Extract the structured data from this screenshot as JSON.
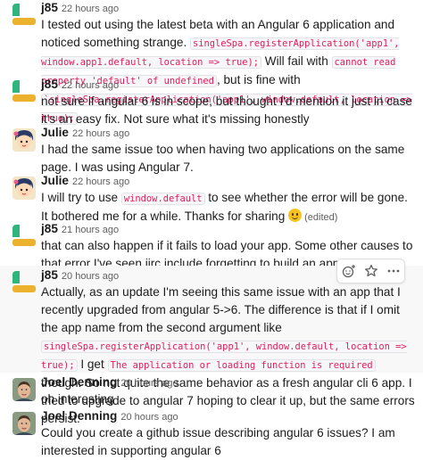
{
  "messages": [
    {
      "author": "j85",
      "time": "22 hours ago",
      "avatar": "slack-green-yellow",
      "parts": [
        {
          "t": "text",
          "v": "I tested out using the latest beta with an Angular 6 application and noticed something strange. "
        },
        {
          "t": "code",
          "v": "singleSpa.registerApplication('app1', window.app1.default, location => true);"
        },
        {
          "t": "text",
          "v": " Will fail with "
        },
        {
          "t": "code",
          "v": "cannot read property 'default' of undefined"
        },
        {
          "t": "text",
          "v": ", but is fine with "
        },
        {
          "t": "code",
          "v": "`singleSpa.registerApplication('app1', window.default, location => true);"
        }
      ]
    },
    {
      "author": "j85",
      "time": "22 hours ago",
      "avatar": "slack-green-yellow",
      "parts": [
        {
          "t": "text",
          "v": "not sure if angular 6 is in scope, but thought I'd mention it just in case it's an easy fix. Not sure what it's missing honestly"
        }
      ]
    },
    {
      "author": "Julie",
      "time": "22 hours ago",
      "avatar": "cartoon-girl",
      "parts": [
        {
          "t": "text",
          "v": "I had the same issue too when having two applications on the same page. I was using Angular 7."
        }
      ]
    },
    {
      "author": "Julie",
      "time": "22 hours ago",
      "avatar": "cartoon-girl",
      "parts": [
        {
          "t": "text",
          "v": "I will try to use "
        },
        {
          "t": "code",
          "v": "window.default"
        },
        {
          "t": "text",
          "v": " to see whether the error will be gone. It bothered me for a while. Thanks for sharing "
        },
        {
          "t": "emoji",
          "v": "slightly-smiling-face"
        },
        {
          "t": "edited",
          "v": " (edited)"
        }
      ]
    },
    {
      "author": "j85",
      "time": "21 hours ago",
      "avatar": "slack-green-yellow",
      "parts": [
        {
          "t": "text",
          "v": "that can also happen if it fails to load your app. Some other causes to that error I've seen iirc include forgetting to build an app, or name collision between the apps."
        }
      ]
    },
    {
      "author": "j85",
      "time": "20 hours ago",
      "avatar": "slack-green-yellow",
      "parts": [
        {
          "t": "text",
          "v": "Actually, as an update I'm seeing this same issue with an app that I recently upgraded from angular 5->6. The difference is that if I omit the app name from the second argument like "
        },
        {
          "t": "code",
          "v": "singleSpa.registerApplication('app1', window.default, location => true);"
        },
        {
          "t": "text",
          "v": " I get "
        },
        {
          "t": "code",
          "v": "The application or loading function is required"
        },
        {
          "t": "text",
          "v": " though. So not quite the same behavior as a fresh angular cli 6 app.  I tried to upgrade to angular 7 hoping to clear it up, but the same errors persist."
        }
      ]
    },
    {
      "author": "Joel Denning",
      "time": "20 hours ago",
      "avatar": "photo-man",
      "parts": [
        {
          "t": "text",
          "v": "oh interesting"
        }
      ]
    },
    {
      "author": "Joel Denning",
      "time": "20 hours ago",
      "avatar": "photo-man",
      "parts": [
        {
          "t": "text",
          "v": "Could you create a github issue describing angular 6 issues? I am interested in supporting angular 6"
        }
      ]
    }
  ],
  "toolbar": {
    "icons": [
      "add-reaction-icon",
      "star-icon",
      "more-actions-icon"
    ]
  },
  "colors": {
    "code_text": "#e01e5a",
    "slack_green": "#2eb67d",
    "slack_yellow": "#ecb22e",
    "muted": "#616061"
  }
}
